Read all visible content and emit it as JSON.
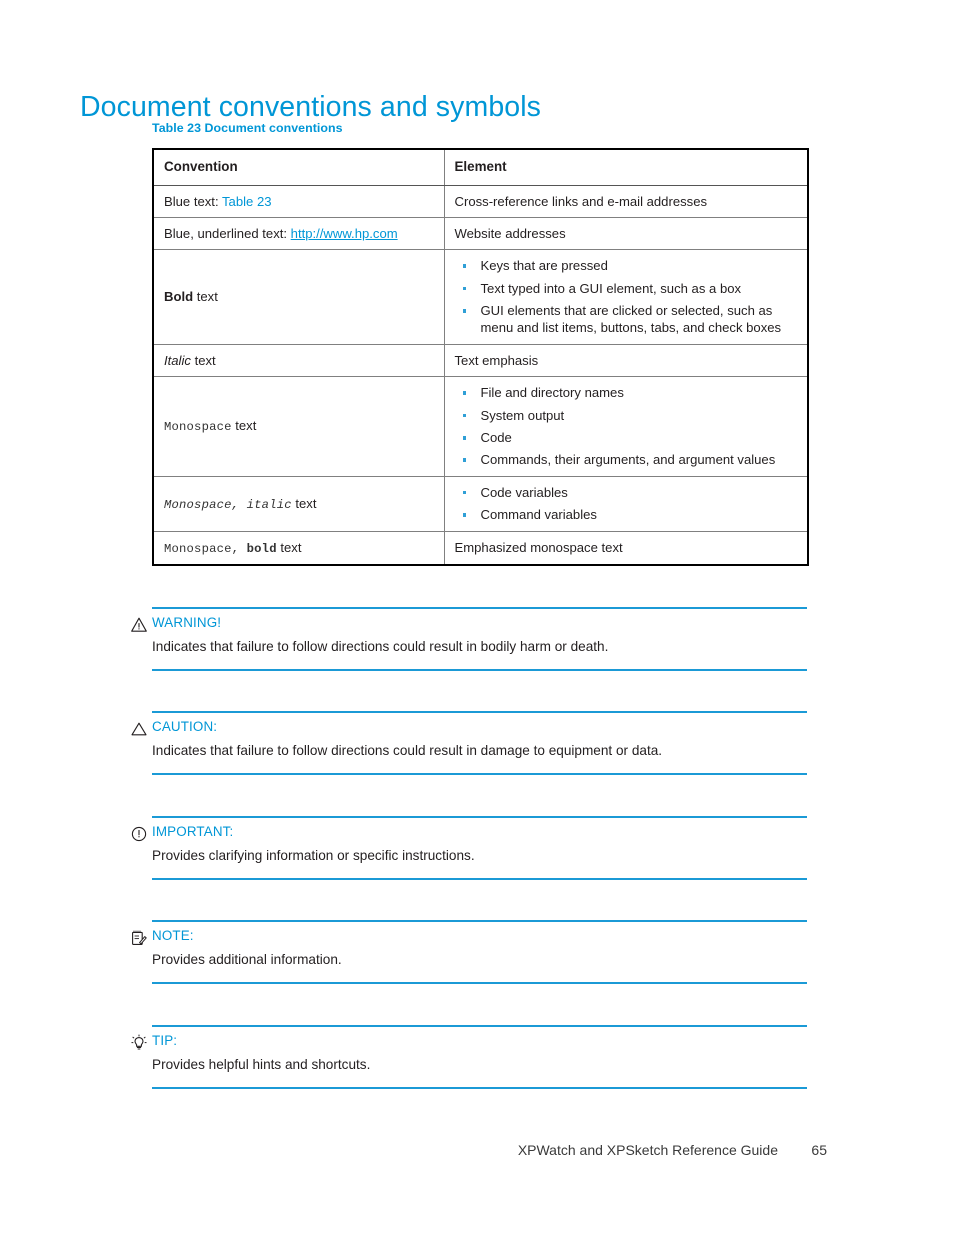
{
  "document": {
    "title": "Document conventions and symbols",
    "accent_color": "#0096d6",
    "text_color": "#231f20"
  },
  "table": {
    "caption": "Table 23 Document conventions",
    "headers": [
      "Convention",
      "Element"
    ],
    "rows": [
      {
        "convention_prefix": "Blue text: ",
        "convention_link": "Table 23",
        "convention_link_underlined": false,
        "element_text": "Cross-reference links and e-mail addresses",
        "element_bullets": []
      },
      {
        "convention_prefix": "Blue, underlined text: ",
        "convention_link": "http://www.hp.com",
        "convention_link_underlined": true,
        "element_text": "Website addresses",
        "element_bullets": []
      },
      {
        "convention_bold": "Bold",
        "convention_suffix": " text",
        "element_text": "",
        "element_bullets": [
          "Keys that are pressed",
          "Text typed into a GUI element, such as a box",
          "GUI elements that are clicked or selected, such as menu and list items, buttons, tabs, and check boxes"
        ]
      },
      {
        "convention_italic": "Italic",
        "convention_suffix": "  text",
        "element_text": "Text emphasis",
        "element_bullets": []
      },
      {
        "convention_mono": "Monospace",
        "convention_suffix": "  text",
        "element_text": "",
        "element_bullets": [
          "File and directory names",
          "System output",
          "Code",
          "Commands, their arguments, and argument values"
        ]
      },
      {
        "convention_mono_italic": "Monospace, italic",
        "convention_suffix": "  text",
        "element_text": "",
        "element_bullets": [
          "Code variables",
          "Command variables"
        ]
      },
      {
        "convention_mono_plain": "Monospace, ",
        "convention_mono_bold": "bold",
        "convention_suffix": "  text",
        "element_text": "Emphasized monospace text",
        "element_bullets": []
      }
    ]
  },
  "admonitions": [
    {
      "icon": "warning-triangle-icon",
      "label": "WARNING!",
      "text": "Indicates that failure to follow directions could result in bodily harm or death."
    },
    {
      "icon": "caution-triangle-icon",
      "label": "CAUTION:",
      "text": "Indicates that failure to follow directions could result in damage to equipment or data."
    },
    {
      "icon": "important-circle-exclamation-icon",
      "label": "IMPORTANT:",
      "text": "Provides clarifying information or specific instructions."
    },
    {
      "icon": "note-notepad-icon",
      "label": "NOTE:",
      "text": "Provides additional information."
    },
    {
      "icon": "tip-lightbulb-icon",
      "label": "TIP:",
      "text": "Provides helpful hints and shortcuts."
    }
  ],
  "footer": {
    "guide_title": "XPWatch and XPSketch Reference Guide",
    "page_number": "65"
  }
}
